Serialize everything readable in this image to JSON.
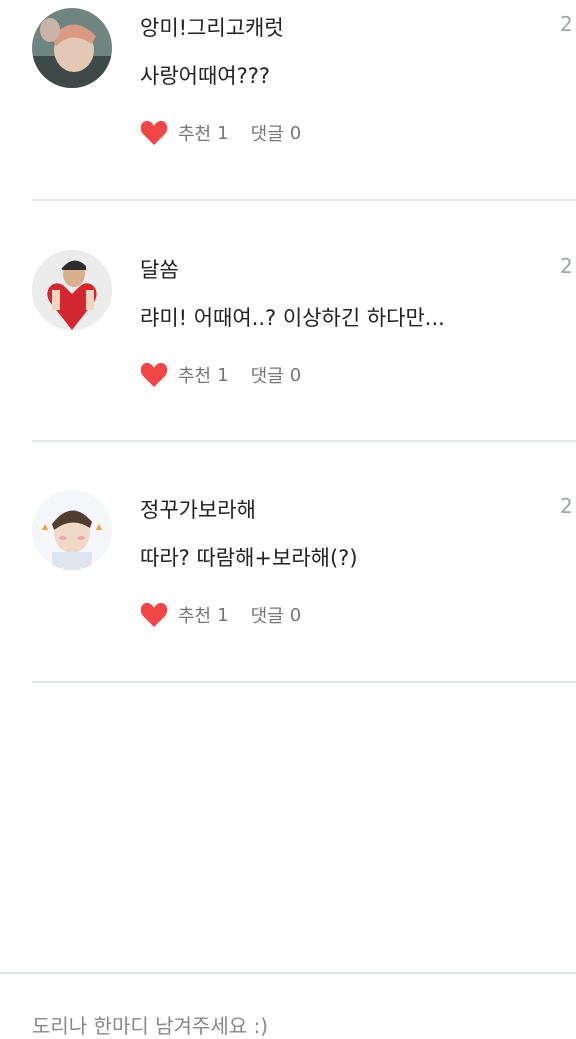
{
  "comments": [
    {
      "username": "앙미!그리고캐럿",
      "text": "사랑어때여???",
      "time_snip": "2",
      "like_label": "추천",
      "like_count": "1",
      "reply_label": "댓글",
      "reply_count": "0",
      "avatar_colors": [
        "#7d8f8a",
        "#d9c3b3"
      ]
    },
    {
      "username": "달쏨",
      "text": "랴미! 어때여..? 이상하긴 하다만...",
      "time_snip": "2",
      "like_label": "추천",
      "like_count": "1",
      "reply_label": "댓글",
      "reply_count": "0",
      "avatar_colors": [
        "#eaeaea",
        "#d2272f"
      ]
    },
    {
      "username": "정꾸가보라해",
      "text": "따라? 따람해+보라해(?)",
      "time_snip": "2",
      "like_label": "추천",
      "like_count": "1",
      "reply_label": "댓글",
      "reply_count": "0",
      "avatar_colors": [
        "#f3f5f8",
        "#5a4637"
      ]
    }
  ],
  "bottom_text": "도리나 한마디 남겨주세요 :)",
  "colors": {
    "heart": "#f04646",
    "divider": "#e3e6e8",
    "muted": "#777777"
  }
}
